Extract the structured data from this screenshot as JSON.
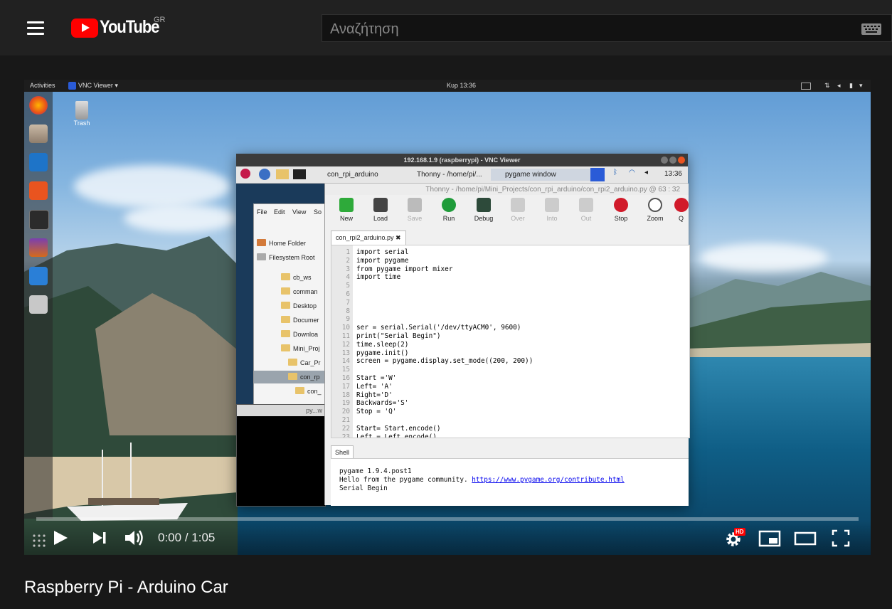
{
  "masthead": {
    "logo_text": "YouTube",
    "country_code": "GR",
    "search_placeholder": "Αναζήτηση"
  },
  "player": {
    "time_current": "0:00",
    "time_separator": " / ",
    "time_total": "1:05",
    "progress_fraction": 0.0,
    "hd_badge": "HD",
    "accent_color": "#ff0000"
  },
  "video_desktop": {
    "gnome_bar": {
      "activities": "Activities",
      "app_menu": "VNC Viewer ▾",
      "clock": "Κυρ 13:36"
    },
    "trash_label": "Trash",
    "vnc_window": {
      "title": "192.168.1.9 (raspberrypi) - VNC Viewer",
      "taskbar_tabs": [
        "con_rpi_arduino",
        "Thonny - /home/pi/...",
        "pygame window"
      ],
      "clock": "13:36"
    },
    "file_manager": {
      "menu": [
        "File",
        "Edit",
        "View",
        "So"
      ],
      "places": [
        "Home Folder",
        "Filesystem Root"
      ],
      "tree": [
        "cb_ws",
        "comman",
        "Desktop",
        "Documer",
        "Downloa",
        "Mini_Proj",
        "Car_Pr",
        "con_rp",
        "con_"
      ]
    },
    "terminal_title": "py...w",
    "thonny": {
      "title": "Thonny - /home/pi/Mini_Projects/con_rpi_arduino/con_rpi2_arduino.py @ 63 : 32",
      "toolbar": [
        "New",
        "Load",
        "Save",
        "Run",
        "Debug",
        "Over",
        "Into",
        "Out",
        "Stop",
        "Zoom",
        "Q"
      ],
      "file_tab": "con_rpi2_arduino.py ✖",
      "code_lines": [
        {
          "n": "1",
          "text": "import serial"
        },
        {
          "n": "2",
          "text": "import pygame"
        },
        {
          "n": "3",
          "text": "from pygame import mixer"
        },
        {
          "n": "4",
          "text": "import time"
        },
        {
          "n": "5",
          "text": ""
        },
        {
          "n": "6",
          "text": ""
        },
        {
          "n": "7",
          "text": ""
        },
        {
          "n": "8",
          "text": ""
        },
        {
          "n": "9",
          "text": ""
        },
        {
          "n": "10",
          "text": "ser = serial.Serial('/dev/ttyACM0', 9600)"
        },
        {
          "n": "11",
          "text": "print(\"Serial Begin\")"
        },
        {
          "n": "12",
          "text": "time.sleep(2)"
        },
        {
          "n": "13",
          "text": "pygame.init()"
        },
        {
          "n": "14",
          "text": "screen = pygame.display.set_mode((200, 200))"
        },
        {
          "n": "15",
          "text": ""
        },
        {
          "n": "16",
          "text": "Start ='W'"
        },
        {
          "n": "17",
          "text": "Left= 'A'"
        },
        {
          "n": "18",
          "text": "Right='D'"
        },
        {
          "n": "19",
          "text": "Backwards='S'"
        },
        {
          "n": "20",
          "text": "Stop = 'Q'"
        },
        {
          "n": "21",
          "text": ""
        },
        {
          "n": "22",
          "text": "Start= Start.encode()"
        },
        {
          "n": "23",
          "text": "Left = Left.encode()"
        }
      ],
      "shell_tab": "Shell",
      "shell_lines": [
        "pygame 1.9.4.post1",
        "Hello from the pygame community. ",
        "Serial Begin"
      ],
      "shell_link": "https://www.pygame.org/contribute.html"
    }
  },
  "video": {
    "title": "Raspberry Pi - Arduino Car"
  }
}
